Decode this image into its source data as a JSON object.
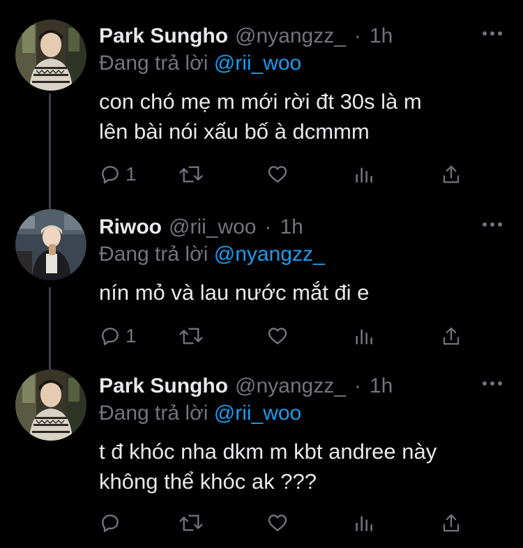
{
  "colors": {
    "background": "#000000",
    "text": "#e7e9ea",
    "secondary": "#71767b",
    "accent": "#1d9bf0",
    "thread_line": "#3a3f44"
  },
  "tweets": [
    {
      "name": "Park Sungho",
      "handle": "@nyangzz_",
      "separator": "·",
      "time": "1h",
      "reply_prefix": "Đang trả lời",
      "reply_to": "@rii_woo",
      "text_lines": [
        "con chó mẹ m mới rời đt 30s là m",
        "lên bài nói xấu bố à dcmmm"
      ],
      "reply_count": "1",
      "icons": [
        "reply-icon",
        "retweet-icon",
        "like-icon",
        "analytics-icon",
        "share-icon",
        "more-icon"
      ]
    },
    {
      "name": "Riwoo",
      "handle": "@rii_woo",
      "separator": "·",
      "time": "1h",
      "reply_prefix": "Đang trả lời",
      "reply_to": "@nyangzz_",
      "text_lines": [
        "nín mỏ và lau nước mắt đi e"
      ],
      "reply_count": "1",
      "icons": [
        "reply-icon",
        "retweet-icon",
        "like-icon",
        "analytics-icon",
        "share-icon",
        "more-icon"
      ]
    },
    {
      "name": "Park Sungho",
      "handle": "@nyangzz_",
      "separator": "·",
      "time": "1h",
      "reply_prefix": "Đang trả lời",
      "reply_to": "@rii_woo",
      "text_lines": [
        "t đ khóc nha dkm m kbt andree này",
        "không thể khóc ak ???"
      ],
      "reply_count": "",
      "icons": [
        "reply-icon",
        "retweet-icon",
        "like-icon",
        "analytics-icon",
        "share-icon",
        "more-icon"
      ]
    }
  ]
}
